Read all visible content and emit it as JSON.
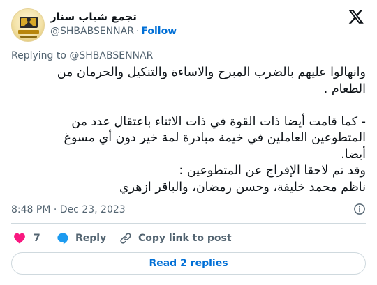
{
  "author": {
    "display_name": "تجمع شباب سنار",
    "handle": "@SHBABSENNAR",
    "separator": "·",
    "follow_label": "Follow",
    "avatar_text": "تجمع شباب سنار"
  },
  "replying_to": {
    "prefix": "Replying to",
    "handle": "@SHBABSENNAR"
  },
  "tweet": {
    "lines": [
      "وانهالوا عليهم بالضرب المبرح والاساءة والتنكيل والحرمان من",
      "الطعام .",
      "",
      "- كما قامت أيضا ذات القوة في ذات الاثناء باعتقال عدد من",
      "المتطوعين العاملين في خيمة مبادرة لمة خير دون أي مسوغ",
      "أيضا.",
      "وقد تم لاحقا الإفراج عن المتطوعين :",
      "ناظم محمد خليفة، وحسن رمضان، والباقر ازهري"
    ],
    "time": "8:48 PM",
    "date_separator": "·",
    "date": "Dec 23, 2023"
  },
  "actions": {
    "like_count": "7",
    "reply_label": "Reply",
    "copy_label": "Copy link to post"
  },
  "read_replies_label": "Read 2 replies",
  "colors": {
    "accent": "#006fd6",
    "like": "#f91880",
    "reply_bubble": "#1d9bf0",
    "muted": "#536471",
    "border": "#cfd9de"
  },
  "icons": [
    "x-logo-icon",
    "info-icon",
    "heart-icon",
    "reply-bubble-icon",
    "link-icon"
  ]
}
